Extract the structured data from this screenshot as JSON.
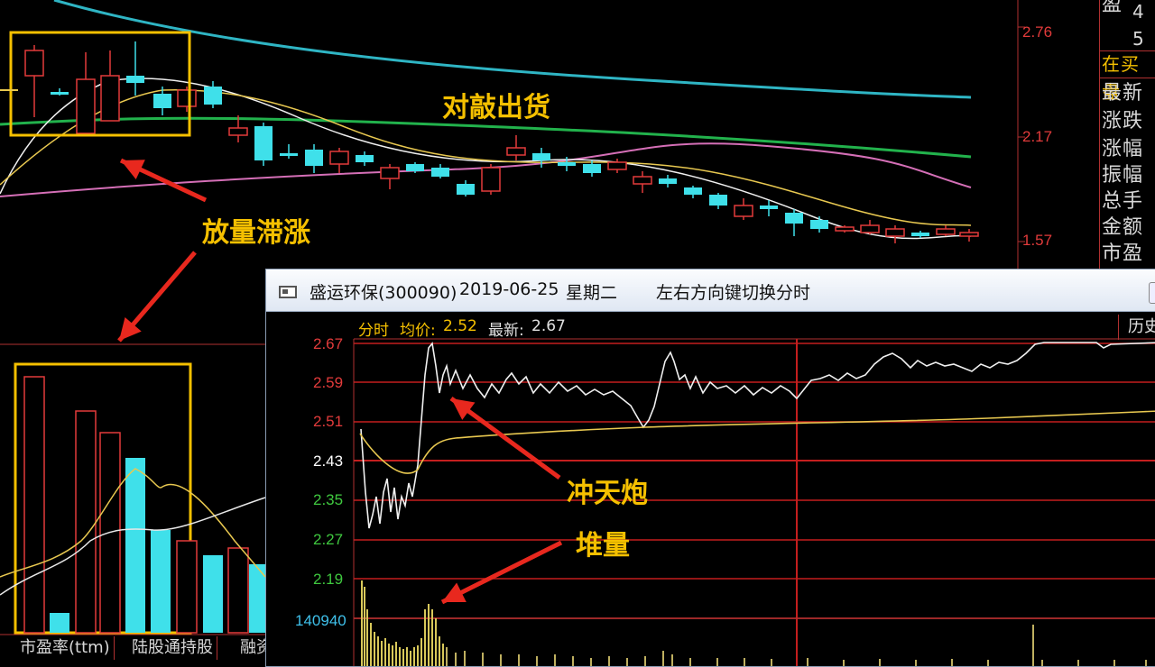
{
  "main_chart": {
    "price_labels": [
      "2.76",
      "2.17",
      "1.57"
    ],
    "side_panel": {
      "top_label": "盈",
      "top_numbers": [
        "4",
        "5"
      ],
      "section": "在买盘",
      "rows": [
        "最新",
        "涨跌",
        "涨幅",
        "振幅",
        "总手",
        "金额",
        "市盈"
      ]
    },
    "annotations": {
      "sell_off": "对敲出货",
      "volume_stall": "放量滞涨",
      "rocket": "冲天炮",
      "pile_volume": "堆量"
    },
    "bottom_tabs": [
      "市盈率(ttm)",
      "陆股通持股",
      "融资"
    ],
    "colors": {
      "up": "#e23b3b",
      "down": "#3fe0ea",
      "highlight": "#f5c000",
      "arrow": "#e8281e"
    }
  },
  "popup": {
    "title_stock": "盛运环保(300090)",
    "title_date": "2019-06-25",
    "title_weekday": "星期二",
    "title_hint": "左右方向键切换分时",
    "header_label": "分时",
    "avg_label": "均价:",
    "avg_value": "2.52",
    "latest_label": "最新:",
    "latest_value": "2.67",
    "history_button": "历史",
    "y_labels": [
      "2.67",
      "2.59",
      "2.51",
      "2.43",
      "2.35",
      "2.27",
      "2.19"
    ],
    "volume_label": "140940"
  }
}
